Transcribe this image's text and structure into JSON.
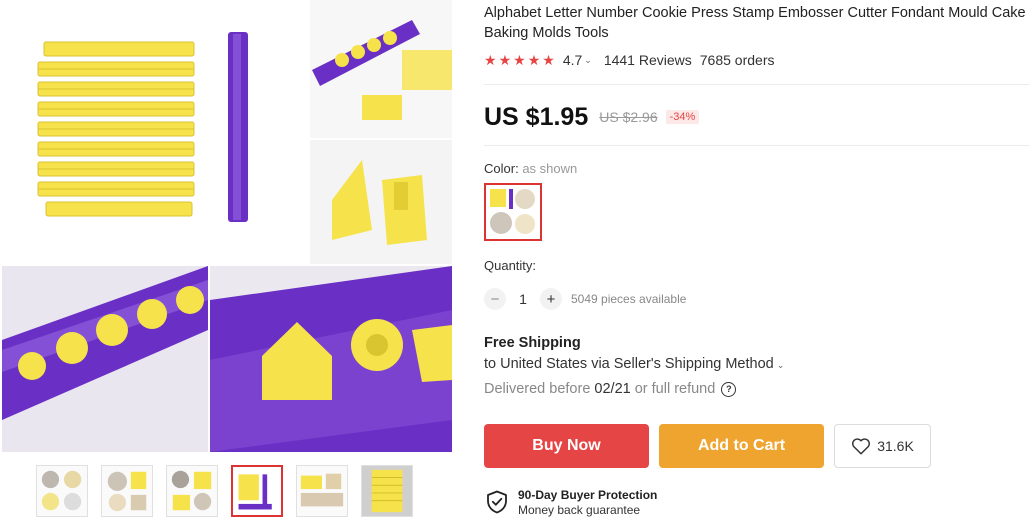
{
  "product": {
    "title": "Alphabet Letter Number Cookie Press Stamp Embosser Cutter Fondant Mould Cake Baking Molds Tools"
  },
  "rating": {
    "stars": 5,
    "value": "4.7",
    "reviews": "1441 Reviews",
    "orders": "7685 orders"
  },
  "pricing": {
    "price": "US $1.95",
    "original": "US $2.96",
    "discount": "-34%"
  },
  "color": {
    "label": "Color:",
    "selected": "as shown"
  },
  "quantity": {
    "label": "Quantity:",
    "value": "1",
    "minus": "−",
    "plus": "+",
    "available": "5049 pieces available"
  },
  "shipping": {
    "title": "Free Shipping",
    "to": "to United States via Seller's Shipping Method",
    "delivery_prefix": "Delivered before",
    "delivery_date": "02/21",
    "delivery_suffix": "or full refund"
  },
  "actions": {
    "buy_now": "Buy Now",
    "add_to_cart": "Add to Cart",
    "wishlist_count": "31.6K"
  },
  "protection": {
    "title": "90-Day Buyer Protection",
    "subtitle": "Money back guarantee"
  },
  "gallery": {
    "thumbnail_count": 6,
    "active_thumbnail": 4
  },
  "colors": {
    "accent_red": "#e64545",
    "cart_orange": "#f0a430",
    "product_yellow": "#f6e24a",
    "product_purple": "#6a2fc4"
  },
  "icons": {
    "star": "star-icon",
    "wishlist": "heart-icon",
    "protection": "shield-check-icon",
    "help": "question-circle-icon"
  }
}
